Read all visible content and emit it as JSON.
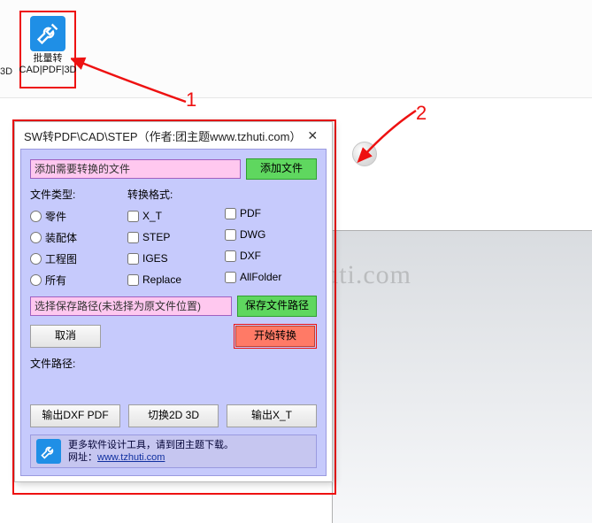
{
  "launcher": {
    "line1": "批量转",
    "line2": "CAD|PDF|3D",
    "side_label": "3D"
  },
  "annotations": {
    "n1": "1",
    "n2": "2"
  },
  "watermark": "团主题www.tzhuti.com",
  "dialog": {
    "title": "SW转PDF\\CAD\\STEP（作者:团主题www.tzhuti.com）",
    "add_placeholder": "添加需要转换的文件",
    "add_btn": "添加文件",
    "type_label": "文件类型:",
    "format_label": "转换格式:",
    "types": [
      "零件",
      "装配体",
      "工程图",
      "所有"
    ],
    "formats_col1": [
      "X_T",
      "STEP",
      "IGES",
      "Replace"
    ],
    "formats_col2": [
      "PDF",
      "DWG",
      "DXF",
      "AllFolder"
    ],
    "save_path_placeholder": "选择保存路径(未选择为原文件位置)",
    "save_btn": "保存文件路径",
    "cancel_btn": "取消",
    "start_btn": "开始转换",
    "paths_label": "文件路径:",
    "bottom_btns": [
      "输出DXF PDF",
      "切换2D 3D",
      "输出X_T"
    ],
    "footer_line1": "更多软件设计工具，请到团主题下载。",
    "footer_line2_label": "网址：",
    "footer_url": "www.tzhuti.com"
  }
}
